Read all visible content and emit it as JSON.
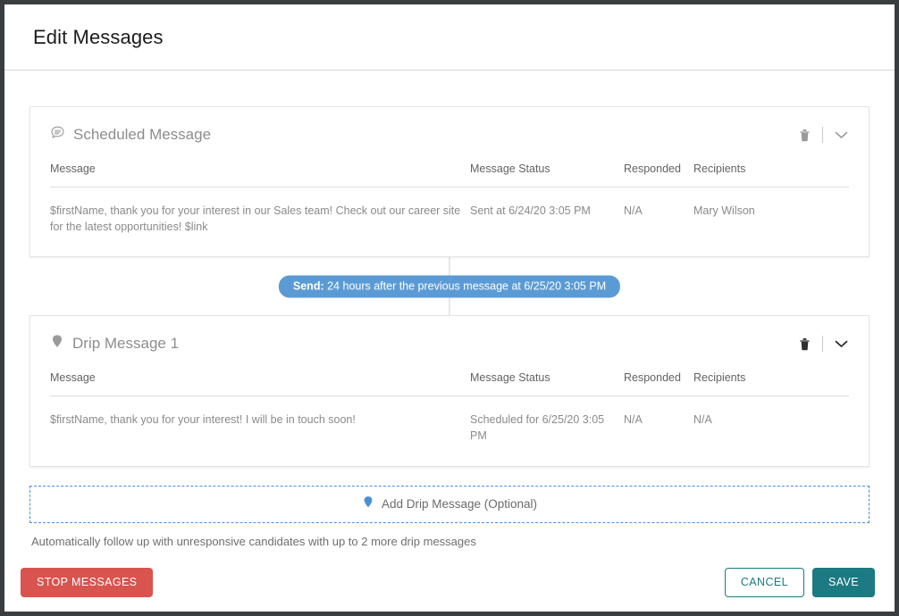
{
  "window": {
    "title": "Edit Messages"
  },
  "colors": {
    "frame": "#3a3d40",
    "pill_blue": "#5b9bd5",
    "drip_blue": "#4a8fd4",
    "teal": "#1b7a82",
    "red": "#d9534f"
  },
  "table_headers": {
    "message": "Message",
    "status": "Message Status",
    "responded": "Responded",
    "recipients": "Recipients"
  },
  "cards": [
    {
      "icon": "speech-bubble-icon",
      "title": "Scheduled Message",
      "delete_icon": "trash-icon",
      "collapse_icon": "chevron-down-icon",
      "row": {
        "message": "$firstName, thank you for your interest in our Sales team! Check out our career site for the latest opportunities! $link",
        "status": "Sent at 6/24/20 3:05 PM",
        "responded": "N/A",
        "recipients": "Mary Wilson"
      }
    },
    {
      "icon": "drip-drop-icon",
      "title": "Drip Message 1",
      "delete_icon": "trash-icon",
      "collapse_icon": "chevron-down-icon",
      "row": {
        "message": "$firstName, thank you for your interest! I will be in touch soon!",
        "status": "Scheduled for 6/25/20 3:05 PM",
        "responded": "N/A",
        "recipients": "N/A"
      }
    }
  ],
  "connector": {
    "send_label": "Send:",
    "send_detail": "24 hours after the previous message at 6/25/20 3:05 PM"
  },
  "add_drip": {
    "icon": "drip-drop-icon",
    "label": "Add Drip Message (Optional)",
    "helper": "Automatically follow up with unresponsive candidates with up to 2 more drip messages"
  },
  "footer": {
    "stop_label": "STOP MESSAGES",
    "cancel_label": "CANCEL",
    "save_label": "SAVE"
  }
}
